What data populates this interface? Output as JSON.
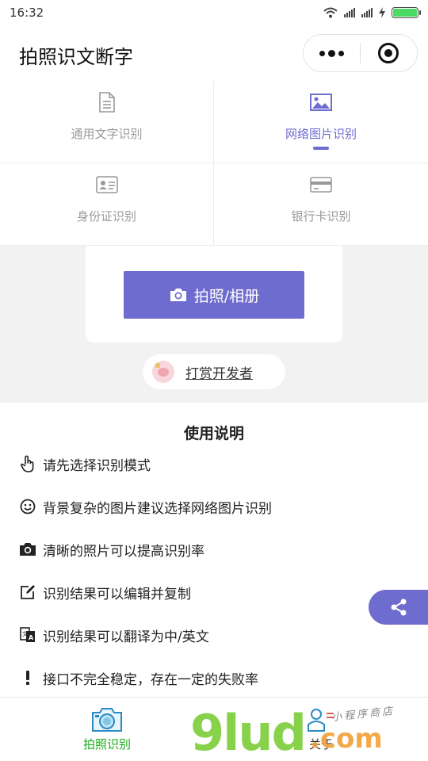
{
  "status_bar": {
    "time": "16:32"
  },
  "nav": {
    "title": "拍照识文断字"
  },
  "modes": [
    {
      "label": "通用文字识别",
      "icon": "document-icon",
      "active": false
    },
    {
      "label": "网络图片识别",
      "icon": "image-icon",
      "active": true
    },
    {
      "label": "身份证识别",
      "icon": "id-card-icon",
      "active": false
    },
    {
      "label": "银行卡识别",
      "icon": "bank-card-icon",
      "active": false
    }
  ],
  "upload": {
    "button_label": "拍照/相册"
  },
  "reward": {
    "label": "打赏开发者"
  },
  "instructions": {
    "title": "使用说明",
    "items": [
      {
        "icon": "pointer-hand-icon",
        "text": "请先选择识别模式"
      },
      {
        "icon": "smiley-icon",
        "text": "背景复杂的图片建议选择网络图片识别"
      },
      {
        "icon": "camera-icon",
        "text": "清晰的照片可以提高识别率"
      },
      {
        "icon": "edit-icon",
        "text": "识别结果可以编辑并复制"
      },
      {
        "icon": "translate-icon",
        "text": "识别结果可以翻译为中/英文"
      },
      {
        "icon": "exclamation-icon",
        "text": "接口不完全稳定，存在一定的失败率"
      }
    ]
  },
  "tabbar": {
    "tabs": [
      {
        "label": "拍照识别",
        "icon": "camera-tab-icon",
        "active": true
      },
      {
        "label": "关于",
        "icon": "person-tab-icon",
        "active": false
      }
    ]
  },
  "watermark": {
    "brand": "9lud",
    "suffix": ".com",
    "tagline": "小程序商店"
  },
  "colors": {
    "accent": "#6f6ccf",
    "tab_active": "#1aad19",
    "background": "#f2f2f2"
  }
}
